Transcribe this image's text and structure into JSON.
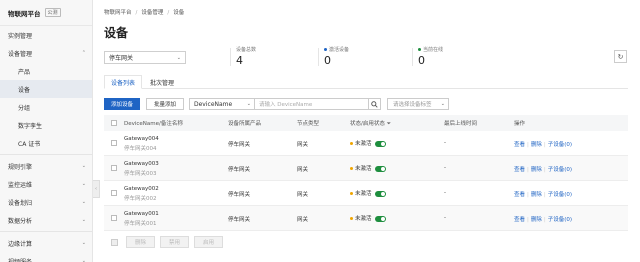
{
  "sidebar": {
    "brand": "物联网平台",
    "brand_badge": "公测",
    "items": [
      {
        "label": "实例管理",
        "sub": false,
        "chev": ""
      },
      {
        "label": "设备管理",
        "sub": false,
        "chev": "⌃"
      },
      {
        "label": "产品",
        "sub": true,
        "chev": ""
      },
      {
        "label": "设备",
        "sub": true,
        "chev": "",
        "active": true
      },
      {
        "label": "分组",
        "sub": true,
        "chev": ""
      },
      {
        "label": "数字孪生",
        "sub": true,
        "chev": ""
      },
      {
        "label": "CA 证书",
        "sub": true,
        "chev": ""
      },
      {
        "label": "规则引擎",
        "sub": false,
        "chev": "⌄"
      },
      {
        "label": "监控运维",
        "sub": false,
        "chev": "⌄"
      },
      {
        "label": "设备划归",
        "sub": false,
        "chev": "⌄"
      },
      {
        "label": "数据分析",
        "sub": false,
        "chev": "⌄"
      },
      {
        "label": "边缘计算",
        "sub": false,
        "chev": "⌄"
      },
      {
        "label": "视频服务",
        "sub": false,
        "chev": "⌄"
      }
    ]
  },
  "breadcrumb": [
    "物联网平台",
    "设备管理",
    "设备"
  ],
  "page_title": "设备",
  "product_select": {
    "value": "停车网关"
  },
  "stats": {
    "total": {
      "label": "设备总数",
      "value": "4"
    },
    "activated": {
      "label": "激活设备",
      "value": "0",
      "color": "#1f64c4"
    },
    "online": {
      "label": "当前在线",
      "value": "0",
      "color": "#1e8e3e"
    }
  },
  "tabs": [
    "设备列表",
    "批次管理"
  ],
  "toolbar": {
    "add_device": "添加设备",
    "batch_add": "批量添加",
    "search_type": "DeviceName",
    "search_placeholder": "请输入 DeviceName",
    "tag_placeholder": "请选择设备标签"
  },
  "table": {
    "columns": [
      "DeviceName/备注名称",
      "设备所属产品",
      "节点类型",
      "状态/启用状态",
      "最后上线时间",
      "操作"
    ],
    "rows": [
      {
        "name": "Gateway004",
        "remark": "停车网关004",
        "product": "停车网关",
        "node": "网关",
        "status": "未激活",
        "last_online": "-",
        "ops": [
          "查看",
          "删除",
          "子设备(0)"
        ]
      },
      {
        "name": "Gateway003",
        "remark": "停车网关003",
        "product": "停车网关",
        "node": "网关",
        "status": "未激活",
        "last_online": "-",
        "ops": [
          "查看",
          "删除",
          "子设备(0)"
        ]
      },
      {
        "name": "Gateway002",
        "remark": "停车网关002",
        "product": "停车网关",
        "node": "网关",
        "status": "未激活",
        "last_online": "-",
        "ops": [
          "查看",
          "删除",
          "子设备(0)"
        ]
      },
      {
        "name": "Gateway001",
        "remark": "停车网关001",
        "product": "停车网关",
        "node": "网关",
        "status": "未激活",
        "last_online": "-",
        "ops": [
          "查看",
          "删除",
          "子设备(0)"
        ]
      }
    ]
  },
  "footer": {
    "buttons": [
      "删除",
      "禁用",
      "启用"
    ]
  }
}
